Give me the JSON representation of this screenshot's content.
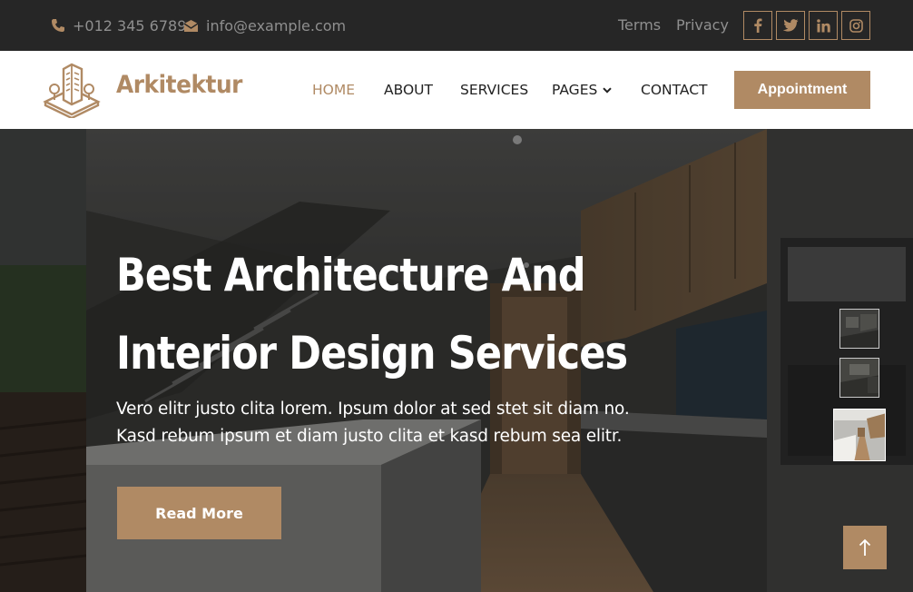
{
  "topbar": {
    "phone": "+012 345 6789",
    "email": "info@example.com",
    "links": [
      "Terms",
      "Privacy"
    ],
    "social_icons": [
      "facebook-icon",
      "twitter-icon",
      "linkedin-icon",
      "instagram-icon"
    ]
  },
  "navbar": {
    "brand": "Arkitektur",
    "items": [
      {
        "label": "HOME",
        "active": true
      },
      {
        "label": "ABOUT"
      },
      {
        "label": "SERVICES"
      },
      {
        "label": "PAGES",
        "dropdown": true
      },
      {
        "label": "CONTACT"
      }
    ],
    "cta": "Appointment"
  },
  "hero": {
    "title_line1": "Best Architecture And",
    "title_line2": "Interior Design Services",
    "subtitle_line1": "Vero elitr justo clita lorem. Ipsum dolor at sed stet sit diam no.",
    "subtitle_line2": "Kasd rebum ipsum et diam justo clita et kasd rebum sea elitr.",
    "button": "Read More",
    "thumbnails": 3
  },
  "colors": {
    "accent": "#b08a64",
    "topbar_bg": "#262626",
    "muted_text": "#8f8f8f"
  }
}
